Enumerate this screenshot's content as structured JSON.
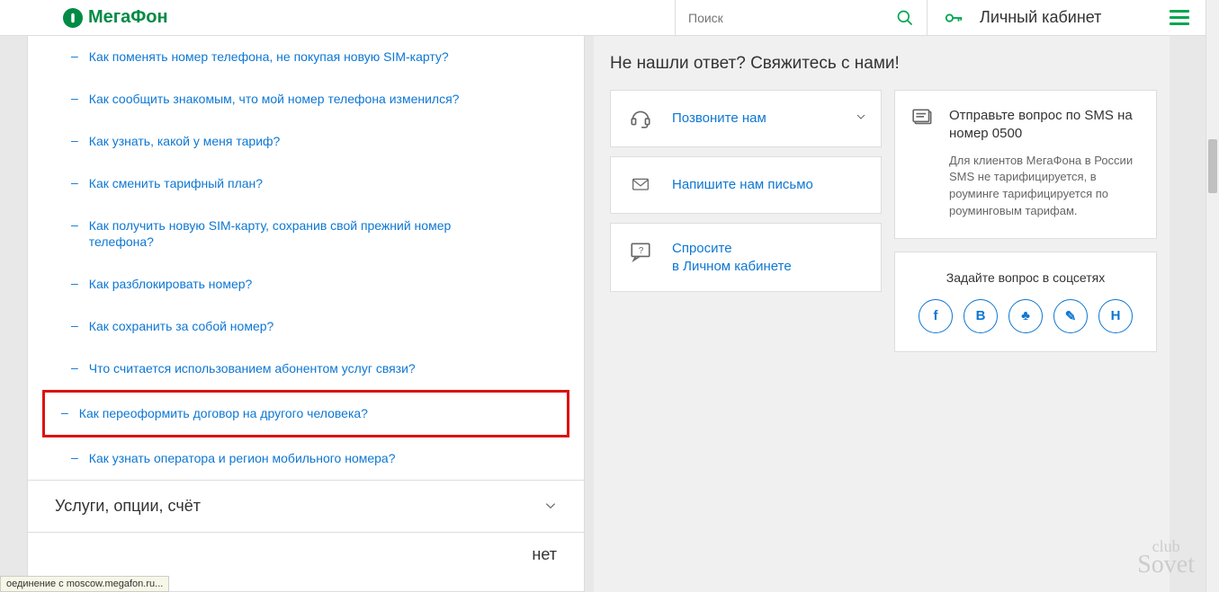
{
  "header": {
    "logo_text": "МегаФон",
    "search_placeholder": "Поиск",
    "cabinet_label": "Личный кабинет"
  },
  "faq": {
    "items": [
      "Как поменять номер телефона, не покупая новую SIM-карту?",
      "Как сообщить знакомым, что мой номер телефона изменился?",
      "Как узнать, какой у меня тариф?",
      "Как сменить тарифный план?",
      "Как получить новую SIM-карту, сохранив свой прежний номер телефона?",
      "Как разблокировать номер?",
      "Как сохранить за собой номер?",
      "Что считается использованием абонентом услуг связи?",
      "Как переоформить договор на другого человека?",
      "Как узнать оператора и регион мобильного номера?"
    ],
    "highlighted_index": 8,
    "accordion1": "Услуги, опции, счёт",
    "accordion2_partial": "нет"
  },
  "contact": {
    "title": "Не нашли ответ? Свяжитесь с нами!",
    "call": "Позвоните нам",
    "write": "Напишите нам письмо",
    "ask_line1": "Спросите",
    "ask_line2": "в Личном кабинете",
    "sms_title": "Отправьте вопрос по SMS на номер 0500",
    "sms_desc": "Для клиентов МегаФона в России SMS не тарифицируется, в роуминге тарифицируется по роуминговым тарифам.",
    "social_title": "Задайте вопрос в соцсетях",
    "social": [
      "f",
      "В",
      "♣",
      "✎",
      "Н"
    ]
  },
  "status_bar": "оединение с moscow.megafon.ru...",
  "watermark": {
    "top": "club",
    "bottom": "Sovet"
  }
}
